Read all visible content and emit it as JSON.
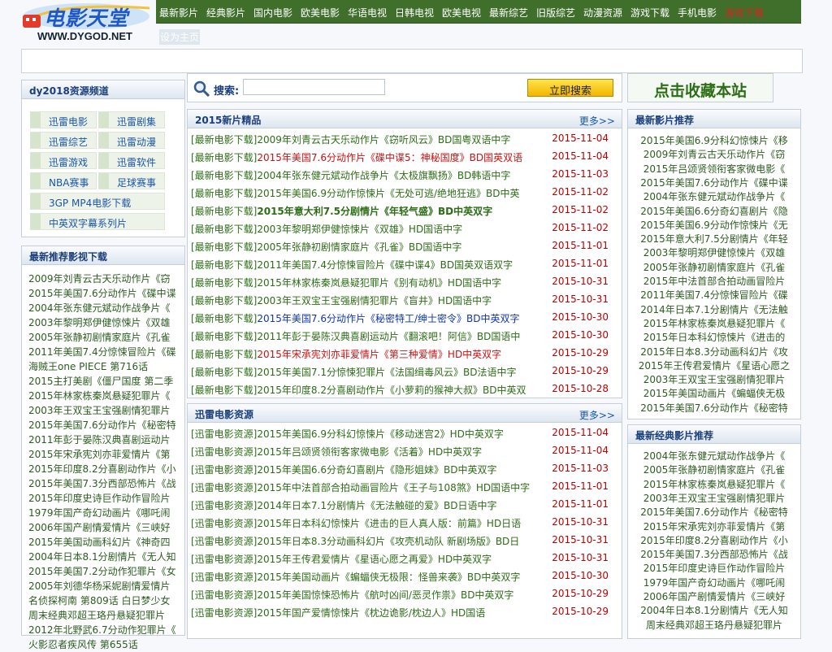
{
  "logo": {
    "title": "电影天堂",
    "url": "WWW.DYGOD.NET"
  },
  "nav": [
    "最新影片",
    "经典影片",
    "国内电影",
    "欧美电影",
    "华语电视",
    "日韩电视",
    "欧美电视",
    "最新综艺",
    "旧版综艺",
    "动漫资源",
    "游戏下载",
    "手机电影",
    "游戏下载"
  ],
  "nav2": "设为主页",
  "search": {
    "label": "搜索:",
    "button": "立即搜索"
  },
  "bookmark": "点击收藏本站",
  "channels": {
    "title": "dy2018资源频道",
    "items": [
      "迅雷电影",
      "迅雷剧集",
      "迅雷综艺",
      "迅雷动漫",
      "迅雷游戏",
      "迅雷软件",
      "NBA赛事",
      "足球赛事",
      "3GP MP4电影下载",
      "中英双字幕系列片"
    ]
  },
  "left_rec": {
    "title": "最新推荐影视下载",
    "items": [
      "2009年刘青云古天乐动作片《窃",
      "2015年美国7.6分动作片《碟中谍",
      "2004年张东健元斌动作战争片《",
      "2003年黎明郑伊健惊悚片《双雄",
      "2005年张静初剧情家庭片《孔雀",
      "2011年美国7.4分惊悚冒险片《碟",
      "海贼王one PIECE 第716话",
      "2015主打美剧《僵尸国度 第二季",
      "2015年林家栋秦岚悬疑犯罪片《",
      "2003年王双宝王宝强剧情犯罪片",
      "2015年美国7.6分动作片《秘密特",
      "2011年彭于晏陈汉典喜剧运动片",
      "2015年宋承宪刘亦菲爱情片《第",
      "2015年印度8.2分喜剧动作片《小",
      "2015年美国7.3分西部恐怖片《战",
      "2015年印度史诗巨作动作冒险片",
      "1979年国产奇幻动画片《哪吒闹",
      "2006年国产剧情爱情片《三峡好",
      "2015年美国动画科幻片《神奇四",
      "2004年日本8.1分剧情片《无人知",
      "2015年美国7.2分动作犯罪片《女",
      "2005年刘德华杨采妮剧情爱情片",
      "名侦探柯南 第809话 白日梦少女",
      "周末经典邓超王珞丹悬疑犯罪片",
      "2012年北野武6.7分动作犯罪片《",
      "火影忍者疾风传 第655话"
    ]
  },
  "new2015": {
    "title": "2015新片精品",
    "more": "更多>>",
    "rows": [
      {
        "prefix": "[最新电影下载]",
        "title": "2009年刘青云古天乐动作片《窃听风云》BD国粤双语中字",
        "date": "2015-11-04",
        "style": "green"
      },
      {
        "prefix": "[最新电影下载]",
        "title": "2015年美国7.6分动作片《碟中谍5：神秘国度》BD国英双语",
        "date": "2015-11-04",
        "style": "red"
      },
      {
        "prefix": "[最新电影下载]",
        "title": "2004年张东健元斌动作战争片《太极旗飘扬》BD韩语中字",
        "date": "2015-11-03",
        "style": "green"
      },
      {
        "prefix": "[最新电影下载]",
        "title": "2015年美国6.9分动作惊悚片《无处可逃/绝地狂逃》BD中英",
        "date": "2015-11-02",
        "style": "green"
      },
      {
        "prefix": "[最新电影下载]",
        "title": "2015年意大利7.5分剧情片《年轻气盛》BD中英双字",
        "date": "2015-11-02",
        "style": "greenbold"
      },
      {
        "prefix": "[最新电影下载]",
        "title": "2003年黎明郑伊健惊悚片《双雄》HD国语中字",
        "date": "2015-11-02",
        "style": "green"
      },
      {
        "prefix": "[最新电影下载]",
        "title": "2005年张静初剧情家庭片《孔雀》BD国语中字",
        "date": "2015-11-01",
        "style": "green"
      },
      {
        "prefix": "[最新电影下载]",
        "title": "2011年美国7.4分惊悚冒险片《碟中谍4》BD国英双语双字",
        "date": "2015-11-01",
        "style": "green"
      },
      {
        "prefix": "[最新电影下载]",
        "title": "2015年林家栋秦岚悬疑犯罪片《别有动机》HD国语中字",
        "date": "2015-10-31",
        "style": "green"
      },
      {
        "prefix": "[最新电影下载]",
        "title": "2003年王双宝王宝强剧情犯罪片《盲井》HD国语中字",
        "date": "2015-10-31",
        "style": "green"
      },
      {
        "prefix": "[最新电影下载]",
        "title": "2015年美国7.6分动作片《秘密特工/绅士密令》BD中英双字",
        "date": "2015-10-30",
        "style": "blue"
      },
      {
        "prefix": "[最新电影下载]",
        "title": "2011年彭于晏陈汉典喜剧运动片《翻滚吧！阿信》BD国语中",
        "date": "2015-10-30",
        "style": "green"
      },
      {
        "prefix": "[最新电影下载]",
        "title": "2015年宋承宪刘亦菲爱情片《第三种爱情》HD中英双字",
        "date": "2015-10-29",
        "style": "red"
      },
      {
        "prefix": "[最新电影下载]",
        "title": "2015年美国7.1分惊悚犯罪片《法国缉毒风云》BD法语中字",
        "date": "2015-10-29",
        "style": "green"
      },
      {
        "prefix": "[最新电影下载]",
        "title": "2015年印度8.2分喜剧动作片《小萝莉的猴神大叔》BD中英双",
        "date": "2015-10-28",
        "style": "green"
      }
    ]
  },
  "xunlei": {
    "title": "迅雷电影资源",
    "more": "更多>>",
    "rows": [
      {
        "prefix": "[迅雷电影资源]",
        "title": "2015年美国6.9分科幻惊悚片《移动迷宫2》HD中英双字",
        "date": "2015-11-04"
      },
      {
        "prefix": "[迅雷电影资源]",
        "title": "2015年吕颂贤领衔客家微电影《活着》HD中英双字",
        "date": "2015-11-04"
      },
      {
        "prefix": "[迅雷电影资源]",
        "title": "2015年美国6.6分奇幻喜剧片《隐形姐妹》BD中英双字",
        "date": "2015-11-03"
      },
      {
        "prefix": "[迅雷电影资源]",
        "title": "2015年中法首部合拍动画冒险片《王子与108煞》HD国语中字",
        "date": "2015-11-01"
      },
      {
        "prefix": "[迅雷电影资源]",
        "title": "2014年日本7.1分剧情片《无法触碰的爱》BD日语中字",
        "date": "2015-11-01"
      },
      {
        "prefix": "[迅雷电影资源]",
        "title": "2015年日本科幻惊悚片《进击的巨人真人版：前篇》HD日语",
        "date": "2015-10-31"
      },
      {
        "prefix": "[迅雷电影资源]",
        "title": "2015年日本8.3分动画科幻片《攻壳机动队 新剧场版》BD日",
        "date": "2015-10-31"
      },
      {
        "prefix": "[迅雷电影资源]",
        "title": "2015年王传君爱情片《星语心愿之再爱》HD中英双字",
        "date": "2015-10-31"
      },
      {
        "prefix": "[迅雷电影资源]",
        "title": "2015年美国动画片《蝙蝠侠无极限：怪兽来袭》BD中英双字",
        "date": "2015-10-30"
      },
      {
        "prefix": "[迅雷电影资源]",
        "title": "2015年美国惊悚恐怖片《航吋凶间/恶灵作祟》BD中英双字",
        "date": "2015-10-29"
      },
      {
        "prefix": "[迅雷电影资源]",
        "title": "2015年国产爱情惊悚片《枕边诡影/枕边人》HD国语",
        "date": "2015-10-29"
      }
    ]
  },
  "right_new": {
    "title": "最新影片推荐",
    "items": [
      "2015年美国6.9分科幻惊悚片《移",
      "2009年刘青云古天乐动作片《窃",
      "2015年吕颂贤领衔客家微电影《",
      "2015年美国7.6分动作片《碟中谍",
      "2004年张东健元斌动作战争片《",
      "2015年美国6.6分奇幻喜剧片《隐",
      "2015年美国6.9分动作惊悚片《无",
      "2015年意大利7.5分剧情片《年轻",
      "2003年黎明郑伊健惊悚片《双雄",
      "2005年张静初剧情家庭片《孔雀",
      "2015年中法首部合拍动画冒险片",
      "2011年美国7.4分惊悚冒险片《碟",
      "2014年日本7.1分剧情片《无法触",
      "2015年林家栋秦岚悬疑犯罪片《",
      "2015年日本科幻惊悚片《进击的",
      "2015年日本8.3分动画科幻片《攻",
      "2015年王传君爱情片《星语心愿之",
      "2003年王双宝王宝强剧情犯罪片",
      "2015年美国动画片《蝙蝠侠无极",
      "2015年美国7.6分动作片《秘密特"
    ]
  },
  "right_classic": {
    "title": "最新经典影片推荐",
    "items": [
      "2004年张东健元斌动作战争片《",
      "2005年张静初剧情家庭片《孔雀",
      "2015年林家栋秦岚悬疑犯罪片《",
      "2003年王双宝王宝强剧情犯罪片",
      "2015年美国7.6分动作片《秘密特",
      "2015年宋承宪刘亦菲爱情片《第",
      "2015年印度8.2分喜剧动作片《小",
      "2015年美国7.3分西部恐怖片《战",
      "2015年印度史诗巨作动作冒险片",
      "1979年国产奇幻动画片《哪吒闹",
      "2006年国产剧情爱情片《三峡好",
      "2004年日本8.1分剧情片《无人知",
      "周末经典邓超王珞丹悬疑犯罪片"
    ]
  }
}
